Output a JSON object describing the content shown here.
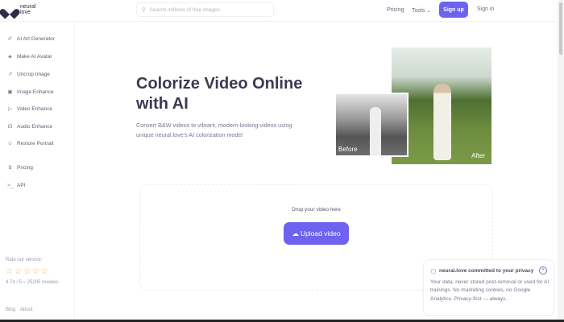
{
  "header": {
    "logo_line1": "neural",
    "logo_line2": "love",
    "search_placeholder": "Search millions of free images",
    "pricing": "Pricing",
    "tools": "Tools",
    "signup": "Sign up",
    "signin": "Sign in"
  },
  "sidebar": {
    "items": [
      {
        "label": "AI Art Generator",
        "icon": "brush-icon"
      },
      {
        "label": "Make AI Avatar",
        "icon": "globe-icon"
      },
      {
        "label": "Uncrop Image",
        "icon": "expand-icon"
      },
      {
        "label": "Image Enhance",
        "icon": "image-icon"
      },
      {
        "label": "Video Enhance",
        "icon": "play-icon"
      },
      {
        "label": "Audio Enhance",
        "icon": "headphones-icon"
      },
      {
        "label": "Restore Portrait",
        "icon": "face-icon"
      },
      {
        "label": "Pricing",
        "icon": "dollar-icon"
      },
      {
        "label": "API",
        "icon": "terminal-icon"
      }
    ],
    "rate_label": "Rate our service:",
    "rating": 0,
    "reviews": "4.74 / 5 – 25205 reviews",
    "blog": "Blog",
    "about": "About"
  },
  "hero": {
    "title": "Colorize Video Online with AI",
    "subtitle": "Convert B&W videos to vibrant, modern-looking videos using unique neural.love's AI colorization model",
    "before_label": "Before",
    "after_label": "After"
  },
  "upload": {
    "drop_text": "Drop your video here",
    "button": "Upload video"
  },
  "privacy": {
    "title": "neural.love committed to your privacy",
    "body": "Your data, never stored post-removal or used for AI trainings. No marketing cookies, no Google Analytics. Privacy-first — always."
  },
  "colors": {
    "accent": "#6d63f0",
    "star": "#f0b35a"
  }
}
